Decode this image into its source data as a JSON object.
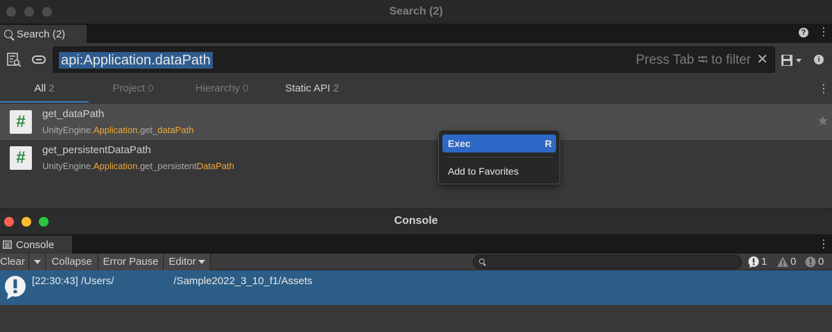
{
  "search_window": {
    "title": "Search (2)",
    "tab_label": "Search (2)",
    "help_symbol": "?",
    "menu_symbol": "⋮",
    "query": "api:Application.dataPath",
    "hint": "Press Tab ⭾ to filter",
    "clear_symbol": "✕",
    "info_symbol": "i",
    "filter_tabs": [
      {
        "label": "All",
        "count": "2"
      },
      {
        "label": "Project",
        "count": "0"
      },
      {
        "label": "Hierarchy",
        "count": "0"
      },
      {
        "label": "Static API",
        "count": "2"
      }
    ],
    "results": [
      {
        "icon_text": "#",
        "label": "get_dataPath",
        "desc_prefix": "UnityEngine.",
        "desc_hl1": "Application",
        "desc_mid": ".get_",
        "desc_hl2": "dataPath"
      },
      {
        "icon_text": "#",
        "label": "get_persistentDataPath",
        "desc_prefix": "UnityEngine.",
        "desc_hl1": "Application",
        "desc_mid": ".get_persistent",
        "desc_hl2": "DataPath"
      }
    ],
    "context_menu": {
      "exec_label": "Exec",
      "exec_shortcut": "R",
      "favorites_label": "Add to Favorites"
    }
  },
  "console_window": {
    "title": "Console",
    "tab_label": "Console",
    "menu_symbol": "⋮",
    "toolbar": {
      "clear_label": "Clear",
      "collapse_label": "Collapse",
      "error_pause_label": "Error Pause",
      "editor_label": "Editor"
    },
    "counts": {
      "info": "1",
      "warning": "0",
      "error": "0"
    },
    "log": {
      "prefix": "[22:30:43] /Users/",
      "suffix": "/Sample2022_3_10_f1/Assets"
    }
  },
  "colors": {
    "selection_blue": "#2c5d87",
    "menu_highlight": "#2e68c6",
    "match_highlight": "#f0a83a",
    "traffic_red": "#ff5f57",
    "traffic_yellow": "#febc2e",
    "traffic_green": "#28c840"
  },
  "icons": [
    "search-icon",
    "list-search-icon",
    "link-icon",
    "help-icon",
    "save-icon",
    "info-icon",
    "star-icon",
    "console-icon",
    "info-message-icon",
    "warning-icon",
    "error-icon"
  ]
}
